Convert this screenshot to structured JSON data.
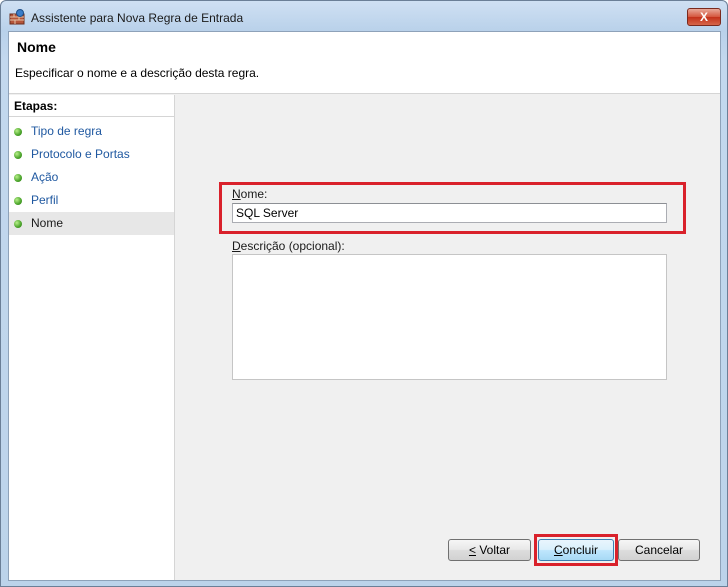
{
  "window": {
    "title": "Assistente para Nova Regra de Entrada",
    "close_label": "X"
  },
  "header": {
    "title": "Nome",
    "description": "Especificar o nome e a descrição desta regra."
  },
  "steps": {
    "header": "Etapas:",
    "items": [
      {
        "label": "Tipo de regra",
        "current": false
      },
      {
        "label": "Protocolo e Portas",
        "current": false
      },
      {
        "label": "Ação",
        "current": false
      },
      {
        "label": "Perfil",
        "current": false
      },
      {
        "label": "Nome",
        "current": true
      }
    ]
  },
  "form": {
    "name_label_mnemonic": "N",
    "name_label_rest": "ome:",
    "name_value": "SQL Server",
    "desc_label_mnemonic": "D",
    "desc_label_rest": "escrição (opcional):",
    "desc_value": ""
  },
  "buttons": {
    "back_mnemonic": "<",
    "back_rest": " Voltar",
    "finish_mnemonic": "C",
    "finish_rest": "oncluir",
    "cancel_label": "Cancelar"
  },
  "colors": {
    "highlight": "#d9212b",
    "link": "#1f58a0",
    "status_dot": "#4aa32a"
  }
}
